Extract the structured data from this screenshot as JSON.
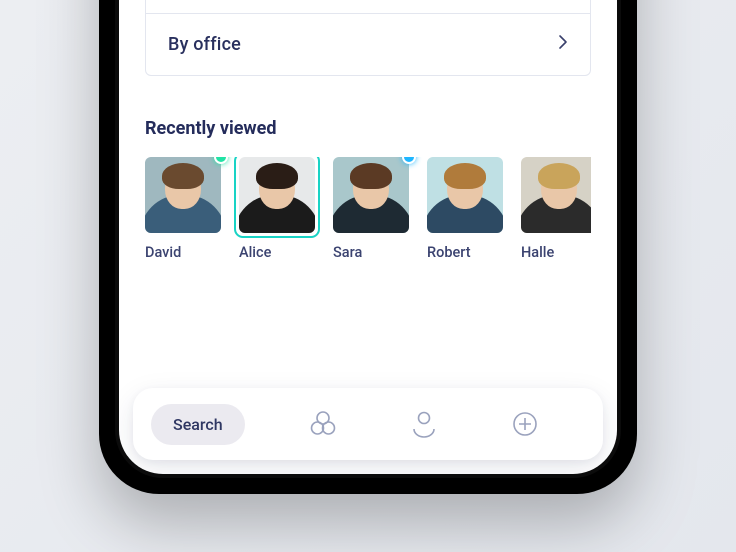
{
  "filter": {
    "label": "By office"
  },
  "recent": {
    "title": "Recently viewed",
    "people": [
      {
        "name": "David",
        "status_color": "#21e3a5",
        "selected": false,
        "bg": "#9fb8bf",
        "shirt": "#3a5e7a",
        "hair": "#6a4a2f"
      },
      {
        "name": "Alice",
        "status_color": null,
        "selected": true,
        "bg": "#e7e9ea",
        "shirt": "#1b1b1b",
        "hair": "#2a1d16"
      },
      {
        "name": "Sara",
        "status_color": "#1fb6ff",
        "selected": false,
        "bg": "#a9c7cb",
        "shirt": "#1e2a33",
        "hair": "#5b3a24"
      },
      {
        "name": "Robert",
        "status_color": null,
        "selected": false,
        "bg": "#bfe0e4",
        "shirt": "#2d4a63",
        "hair": "#b07b3b"
      },
      {
        "name": "Halle",
        "status_color": null,
        "selected": false,
        "bg": "#d6d2c6",
        "shirt": "#2b2b2b",
        "hair": "#c9a45b"
      }
    ]
  },
  "tabs": {
    "active_label": "Search",
    "icons": [
      "groups-icon",
      "profile-icon",
      "add-icon"
    ]
  }
}
